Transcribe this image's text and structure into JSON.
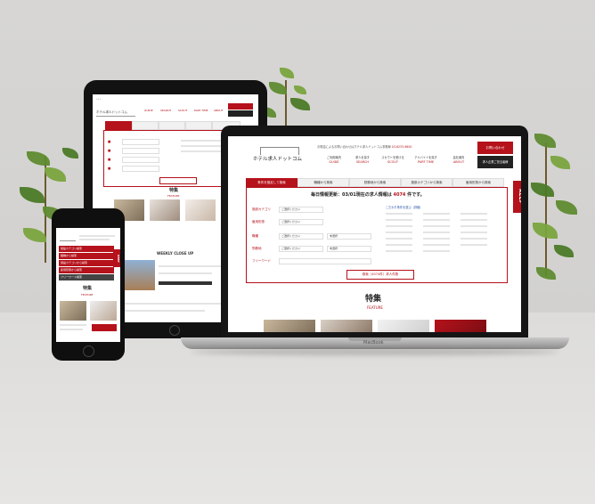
{
  "site": {
    "logo_text": "ホテル求人ドットコム",
    "top_notice": "お電話によるお問い合わせはホテル求人ドットコム事務局",
    "phone": "03-6233-9600",
    "contact_button": "お問い合わせ",
    "company_button": "求人企業ご担当者様"
  },
  "nav": [
    {
      "jp": "ご利用案内",
      "en": "GUIDE"
    },
    {
      "jp": "求人を探す",
      "en": "SEARCH"
    },
    {
      "jp": "スカウトを受ける",
      "en": "SCOUT"
    },
    {
      "jp": "アルバイトを探す",
      "en": "PART TIME"
    },
    {
      "jp": "会社案内",
      "en": "ABOUT"
    }
  ],
  "search_tabs": [
    "条件を指定して検索",
    "職種から検索",
    "勤務地から検索",
    "施設カテゴリから検索",
    "雇用形態から検索"
  ],
  "update_text": "毎日情報更新：03/01現在の求人情報は",
  "update_count": "4074",
  "update_suffix": "件です。",
  "form": {
    "labels": [
      "施設カテゴリ",
      "雇用形態",
      "職種",
      "勤務地",
      "フリーワード"
    ],
    "select_placeholder": "ご選択ください",
    "select_placeholder_2": "未選択",
    "detail_link": "こだわり条件を選ぶ（詳細）",
    "search_button": "検索（4074件）求人件数"
  },
  "feature": {
    "title": "特集",
    "sub": "FEATURE"
  },
  "weekly": "WEEKLY CLOSE UP",
  "keep_label": "KEEP",
  "laptop_brand": "MacBook",
  "phone_menu": [
    "施設カテゴリ検索",
    "職種から検索",
    "施設カテゴリから検索",
    "雇用形態から検索"
  ],
  "phone_button": "フリーワード検索"
}
